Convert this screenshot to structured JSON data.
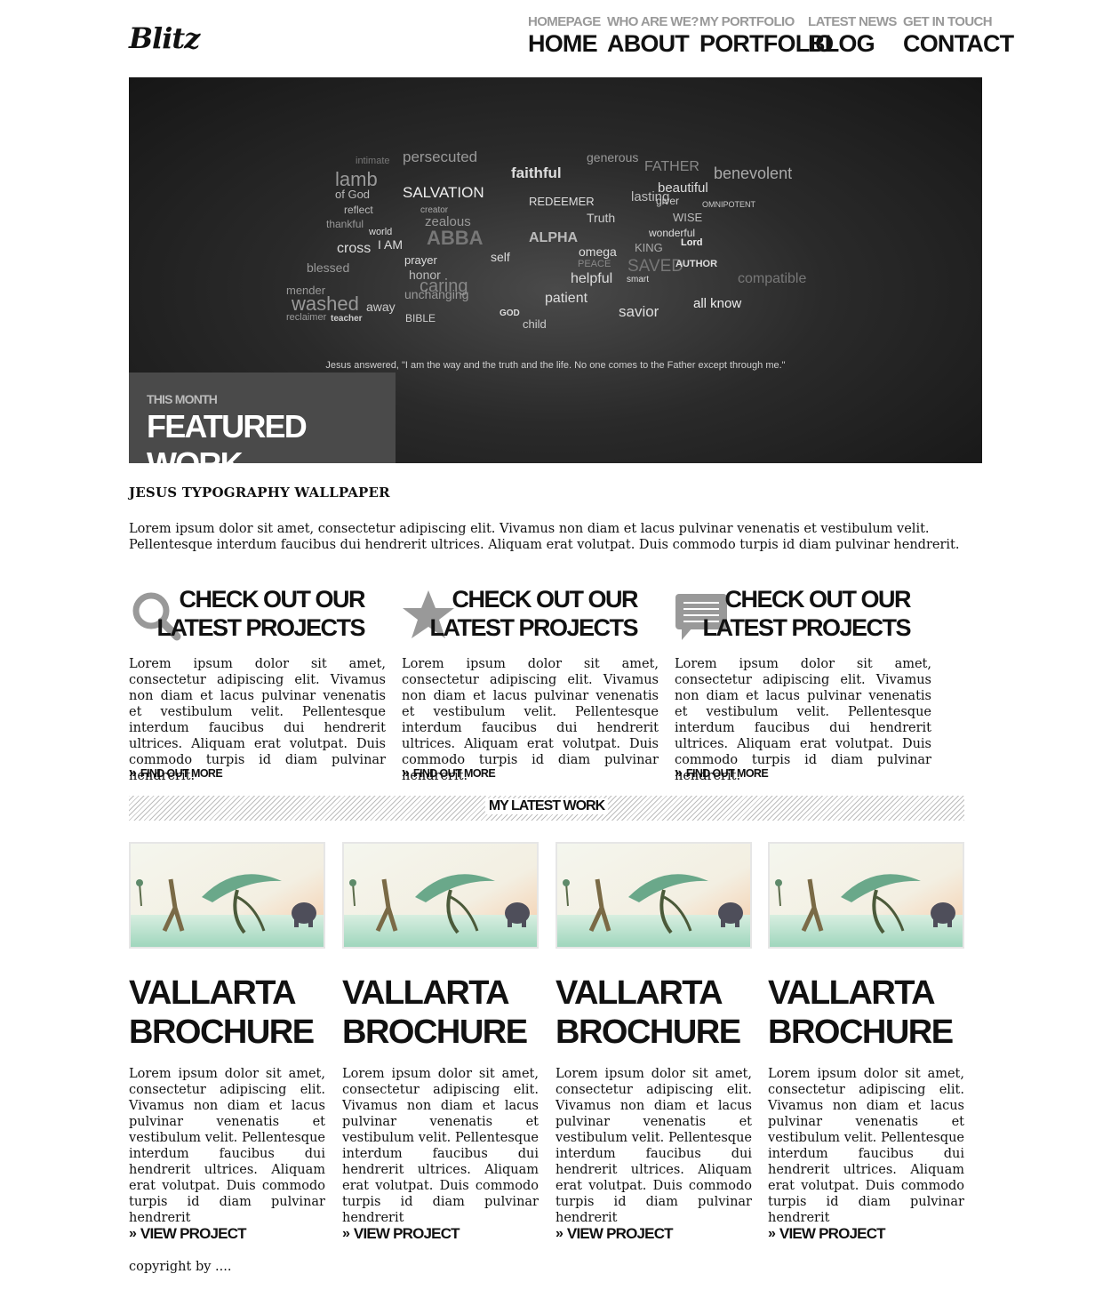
{
  "logo": "Blitz",
  "nav": [
    {
      "sub": "HOMEPAGE",
      "main": "HOME"
    },
    {
      "sub": "WHO ARE WE?",
      "main": "ABOUT"
    },
    {
      "sub": "MY PORTFOLIO",
      "main": "PORTFOLIO"
    },
    {
      "sub": "LATEST NEWS",
      "main": "BLOG"
    },
    {
      "sub": "GET IN TOUCH",
      "main": "CONTACT"
    }
  ],
  "hero": {
    "quote": "Jesus answered, \"I am the way and the truth and the life. No one comes to the Father except through me.\"",
    "words": [
      "intimate",
      "persecuted",
      "generous",
      "FATHER",
      "benevolent",
      "lamb",
      "faithful",
      "of God",
      "SALVATION",
      "REDEEMER",
      "beautiful",
      "reflect",
      "creator",
      "lasting",
      "giver",
      "OMNIPOTENT",
      "thankful",
      "zealous",
      "Truth",
      "WISE",
      "world",
      "ABBA",
      "ALPHA",
      "wonderful",
      "cross",
      "I AM",
      "omega",
      "KING",
      "Lord",
      "blessed",
      "prayer",
      "self",
      "PEACE",
      "SAVED",
      "AUTHOR",
      "honor",
      "caring",
      "helpful",
      "smart",
      "mender",
      "unchanging",
      "patient",
      "compatible",
      "washed",
      "BIBLE",
      "savior",
      "all know",
      "away",
      "child",
      "teacher",
      "reclaimer",
      "GOD"
    ],
    "featured_sub": "THIS MONTH",
    "featured_title": "FEATURED WORK"
  },
  "intro": {
    "title": "JESUS TYPOGRAPHY WALLPAPER",
    "text": "Lorem ipsum dolor sit amet, consectetur adipiscing elit. Vivamus non diam et lacus pulvinar venenatis et vestibulum velit. Pellentesque interdum faucibus dui hendrerit ultrices. Aliquam erat volutpat. Duis commodo turpis id diam pulvinar hendrerit."
  },
  "features": [
    {
      "icon": "search-icon",
      "title_line1": "CHECK OUT OUR",
      "title_line2": "LATEST PROJECTS",
      "text": "Lorem ipsum dolor sit amet, consectetur adipiscing elit. Vivamus non diam et lacus pulvinar venenatis et vestibulum velit. Pellentesque interdum faucibus dui hendrerit ultrices. Aliquam erat volutpat. Duis commodo turpis id diam pulvinar hendrerit.",
      "link": "FIND OUT MORE"
    },
    {
      "icon": "star-icon",
      "title_line1": "CHECK OUT OUR",
      "title_line2": "LATEST PROJECTS",
      "text": "Lorem ipsum dolor sit amet, consectetur adipiscing elit. Vivamus non diam et lacus pulvinar venenatis et vestibulum velit. Pellentesque interdum faucibus dui hendrerit ultrices. Aliquam erat volutpat. Duis commodo turpis id diam pulvinar hendrerit.",
      "link": "FIND OUT MORE"
    },
    {
      "icon": "chat-bubble-icon",
      "title_line1": "CHECK OUT OUR",
      "title_line2": "LATEST PROJECTS",
      "text": "Lorem ipsum dolor sit amet, consectetur adipiscing elit. Vivamus non diam et lacus pulvinar venenatis et vestibulum velit. Pellentesque interdum faucibus dui hendrerit ultrices. Aliquam erat volutpat. Duis commodo turpis id diam pulvinar hendrerit.",
      "link": "FIND OUT MORE"
    }
  ],
  "latest_work": {
    "heading": "MY LATEST WORK",
    "items": [
      {
        "title_line1": "VALLARTA",
        "title_line2": "BROCHURE",
        "text": "Lorem ipsum dolor sit amet, consectetur adipiscing elit. Vivamus non diam et lacus pulvinar venenatis et vestibulum velit. Pellentesque interdum faucibus dui hendrerit ultrices. Aliquam erat volutpat. Duis commodo turpis id diam pulvinar hendrerit",
        "link": "VIEW PROJECT"
      },
      {
        "title_line1": "VALLARTA",
        "title_line2": "BROCHURE",
        "text": "Lorem ipsum dolor sit amet, consectetur adipiscing elit. Vivamus non diam et lacus pulvinar venenatis et vestibulum velit. Pellentesque interdum faucibus dui hendrerit ultrices. Aliquam erat volutpat. Duis commodo turpis id diam pulvinar hendrerit",
        "link": "VIEW PROJECT"
      },
      {
        "title_line1": "VALLARTA",
        "title_line2": "BROCHURE",
        "text": "Lorem ipsum dolor sit amet, consectetur adipiscing elit. Vivamus non diam et lacus pulvinar venenatis et vestibulum velit. Pellentesque interdum faucibus dui hendrerit ultrices. Aliquam erat volutpat. Duis commodo turpis id diam pulvinar hendrerit",
        "link": "VIEW PROJECT"
      },
      {
        "title_line1": "VALLARTA",
        "title_line2": "BROCHURE",
        "text": "Lorem ipsum dolor sit amet, consectetur adipiscing elit. Vivamus non diam et lacus pulvinar venenatis et vestibulum velit. Pellentesque interdum faucibus dui hendrerit ultrices. Aliquam erat volutpat. Duis commodo turpis id diam pulvinar hendrerit",
        "link": "VIEW PROJECT"
      }
    ]
  },
  "footer": {
    "copyright": "copyright by ...."
  },
  "colors": {
    "nav_sub": "#999999",
    "text": "#111111",
    "featured_box": "#4a4a4a",
    "icon_gray": "#999999"
  }
}
